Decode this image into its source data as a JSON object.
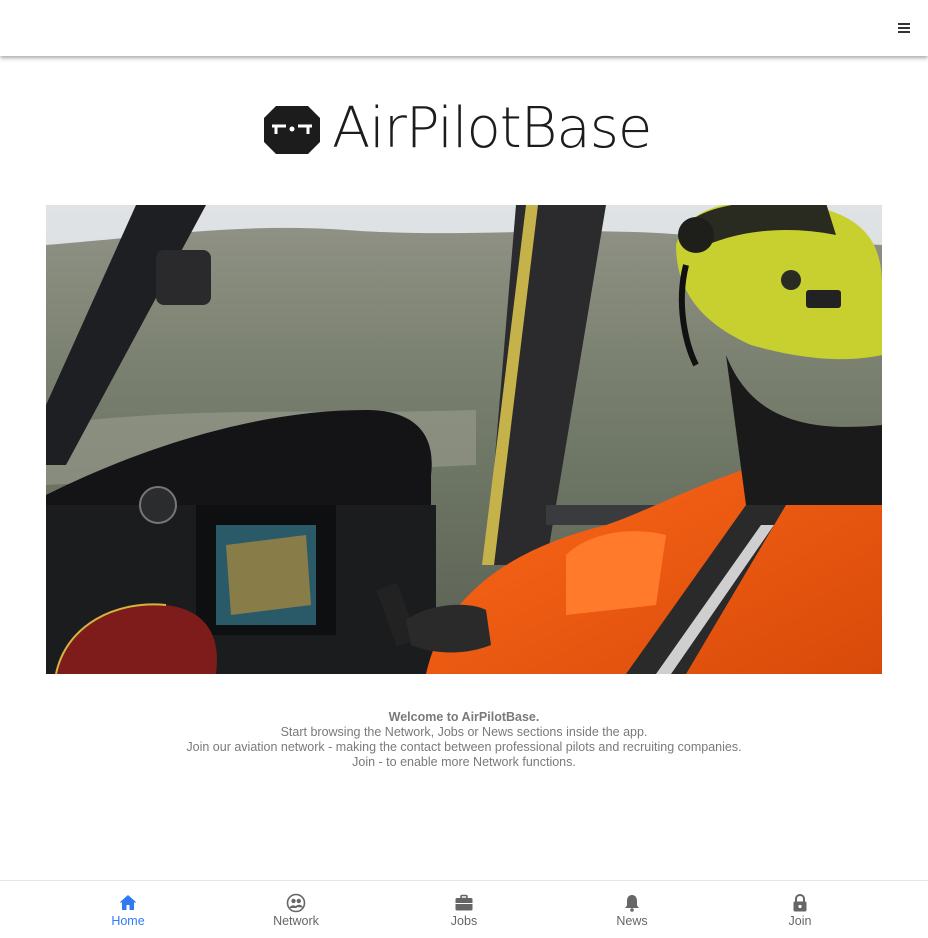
{
  "header": {
    "menu_icon": "hamburger-menu-icon"
  },
  "brand": {
    "name": "AirPilotBase",
    "logo_icon": "airpilotbase-hexagon-logo",
    "color": "#1c1c1c"
  },
  "hero": {
    "image_icon": "helicopter-cockpit-photo"
  },
  "welcome": {
    "title": "Welcome to AirPilotBase.",
    "line1": "Start browsing the Network, Jobs or News sections inside the app.",
    "line2": "Join our aviation network - making the contact between professional pilots and recruiting companies.",
    "line3": "Join - to enable more Network functions."
  },
  "nav": {
    "active_color": "#2f7bf5",
    "inactive_color": "#666666",
    "items": [
      {
        "label": "Home",
        "icon": "home-icon",
        "active": true
      },
      {
        "label": "Network",
        "icon": "network-icon",
        "active": false
      },
      {
        "label": "Jobs",
        "icon": "briefcase-icon",
        "active": false
      },
      {
        "label": "News",
        "icon": "bell-icon",
        "active": false
      },
      {
        "label": "Join",
        "icon": "lock-icon",
        "active": false
      }
    ]
  }
}
